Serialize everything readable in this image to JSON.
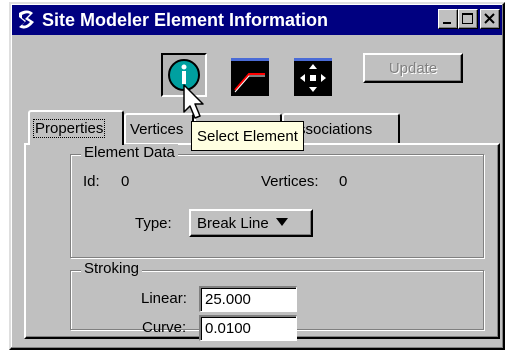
{
  "window": {
    "title": "Site Modeler Element Information",
    "app_icon": "site-modeler-icon"
  },
  "title_buttons": {
    "minimize": "minimize-icon",
    "maximize": "maximize-icon",
    "close": "close-icon"
  },
  "toolbar": {
    "buttons": [
      {
        "icon": "info-icon",
        "pressed": true
      },
      {
        "icon": "break-line-icon",
        "pressed": false
      },
      {
        "icon": "move-arrows-icon",
        "pressed": false
      }
    ],
    "update_label": "Update"
  },
  "tabs": [
    {
      "label": "Properties",
      "active": true
    },
    {
      "label": "Vertices",
      "active": false
    },
    {
      "label": "",
      "active": false
    },
    {
      "label": "Associations",
      "active": false
    }
  ],
  "tooltip": "Select Element",
  "element_data": {
    "legend": "Element Data",
    "id_label": "Id:",
    "id_value": "0",
    "vertices_label": "Vertices:",
    "vertices_value": "0",
    "type_label": "Type:",
    "type_value": "Break Line"
  },
  "stroking": {
    "legend": "Stroking",
    "linear_label": "Linear:",
    "linear_value": "25.000",
    "curve_label": "Curve:",
    "curve_value": "0.0100"
  },
  "colors": {
    "titlebar": "#000080",
    "face": "#c0c0c0",
    "tooltip": "#ffffe1",
    "info_icon": "#00a0a0",
    "line_red": "#ff0000"
  }
}
